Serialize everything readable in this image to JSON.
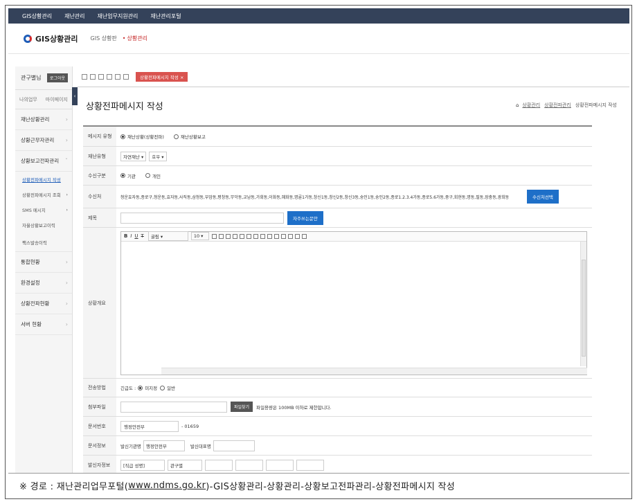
{
  "topnav": {
    "items": [
      "GIS상황관리",
      "재난관리",
      "재난업무지원관리",
      "재난관리포털"
    ]
  },
  "brand": {
    "name": "GIS상황관리",
    "sub1": "GIS 상황판",
    "sub2": "상황관리"
  },
  "sidebar": {
    "head_label": "관구별님",
    "head_button": "로그아웃",
    "sub_left": "나의업무",
    "sub_right": "마이페이지",
    "items": [
      {
        "label": "재난상황관리"
      },
      {
        "label": "상황근무자관리"
      },
      {
        "label": "상황보고전파관리"
      }
    ],
    "subitems": [
      {
        "label": "상황전파메시지 작성"
      },
      {
        "label": "상황전파메시지 조회"
      },
      {
        "label": "SMS 메시지"
      },
      {
        "label": "자율상황보고이력"
      },
      {
        "label": "팩스발송이력"
      }
    ],
    "items2": [
      {
        "label": "통합현황"
      },
      {
        "label": "환경설정"
      },
      {
        "label": "상황전파현황"
      },
      {
        "label": "서버 현황"
      }
    ]
  },
  "tabs": {
    "active": "상황전파메시지 작성"
  },
  "page": {
    "title": "상황전파메시지 작성",
    "breadcrumb": [
      "상황관리",
      "상황전파관리",
      "상황전파메시지 작성"
    ]
  },
  "form": {
    "msg_type": {
      "label": "메시지 유형",
      "opt1": "재난상황(상황전파)",
      "opt2": "재난상황보고"
    },
    "disaster_type": {
      "label": "재난유형",
      "sel1": "자연재난",
      "sel2": "호우"
    },
    "recipient_type": {
      "label": "수신구분",
      "opt1": "기관",
      "opt2": "개인"
    },
    "recipients": {
      "label": "수신처",
      "value": "청운효자동,종로구,청운동,효자동,사직동,삼청동,부암동,평창동,무악동,교남동,가회동,이화동,혜화동,명륜1가동,창신1동,창신2동,창신3동,숭인1동,숭인2동,종로1.2.3.4가동,종로5.6가동,중구,회현동,명동,필동,장충동,광희동",
      "button": "수신처선택"
    },
    "subject": {
      "label": "제목",
      "button": "자주쓰는문안"
    },
    "overview": {
      "label": "상황개요",
      "font": "굴림",
      "size": "10"
    },
    "send_method": {
      "label": "전송방법",
      "prefix": "긴급도 :",
      "opt1": "미지정",
      "opt2": "일반"
    },
    "attachment": {
      "label": "첨부파일",
      "button": "파일찾기",
      "note": "파일용량은 100MB 이하로 제한합니다."
    },
    "doc_no": {
      "label": "문서번호",
      "org": "행정안전부",
      "num": "- 01659"
    },
    "doc_info": {
      "label": "문서정보",
      "sender_label": "발신기관명",
      "sender": "행정안전부",
      "phone_label": "발신대표명"
    },
    "sender_info": {
      "label": "발신자정보",
      "title_label": "[직급 성명]",
      "name": "관구별"
    }
  },
  "footer": {
    "prefix": "※ 경로 : 재난관리업무포털(",
    "url": "www.ndms.go.kr",
    "suffix": ")-GIS상황관리-상황관리-상황보고전파관리-상황전파메시지 작성"
  }
}
